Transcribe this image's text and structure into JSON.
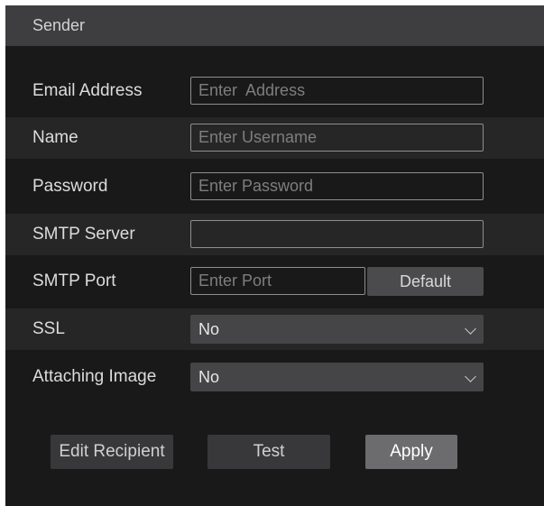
{
  "header": {
    "title": "Sender"
  },
  "form": {
    "email_label": "Email Address",
    "email_placeholder": "Enter  Address",
    "name_label": "Name",
    "name_placeholder": "Enter Username",
    "password_label": "Password",
    "password_placeholder": "Enter Password",
    "smtp_server_label": "SMTP Server",
    "smtp_server_value": "",
    "smtp_port_label": "SMTP Port",
    "smtp_port_placeholder": "Enter Port",
    "default_label": "Default",
    "ssl_label": "SSL",
    "ssl_value": "No",
    "attach_label": "Attaching Image",
    "attach_value": "No"
  },
  "actions": {
    "edit_recipient": "Edit Recipient",
    "test": "Test",
    "apply": "Apply"
  }
}
